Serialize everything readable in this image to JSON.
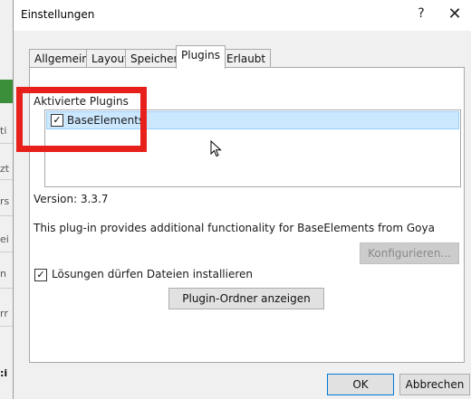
{
  "dialog": {
    "title": "Einstellungen",
    "help_label": "?",
    "close_label": "✕"
  },
  "tabs": [
    {
      "label": "Allgemein"
    },
    {
      "label": "Layout"
    },
    {
      "label": "Speicher"
    },
    {
      "label": "Plugins"
    },
    {
      "label": "Erlaubt"
    }
  ],
  "active_tab": "Plugins",
  "plugins": {
    "list_label": "Aktivierte Plugins",
    "items": [
      {
        "name": "BaseElements",
        "checked": true
      }
    ],
    "version": "Version: 3.3.7",
    "description": "This plug-in provides additional functionality for BaseElements from Goya",
    "configure_label": "Konfigurieren...",
    "allow_install_label": "Lösungen dürfen Dateien installieren",
    "show_folder_label": "Plugin-Ordner anzeigen"
  },
  "buttons": {
    "ok": "OK",
    "cancel": "Abbrechen"
  },
  "background_fragments": [
    "ti",
    "zt",
    "rs",
    "ei",
    "n",
    "rr",
    ":i"
  ],
  "colors": {
    "highlight": "#e8201b",
    "selection": "#cce8ff",
    "accent_green": "#3b8f3b"
  }
}
